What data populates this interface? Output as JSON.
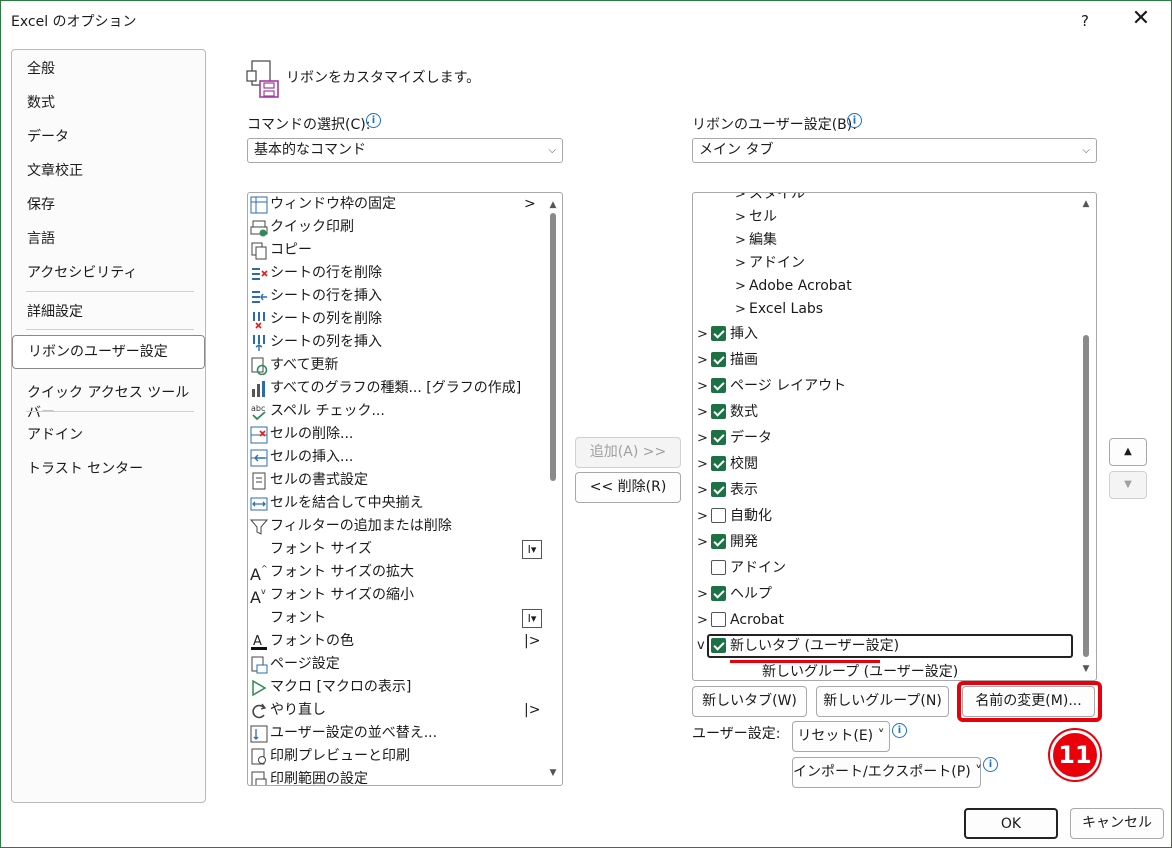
{
  "window": {
    "title": "Excel のオプション",
    "help": "?",
    "close": "✕"
  },
  "nav": {
    "items": [
      "全般",
      "数式",
      "データ",
      "文章校正",
      "保存",
      "言語",
      "アクセシビリティ",
      "詳細設定",
      "リボンのユーザー設定",
      "クイック アクセス ツール バー",
      "アドイン",
      "トラスト センター"
    ],
    "selected": "リボンのユーザー設定"
  },
  "header": {
    "text": "リボンをカスタマイズします。"
  },
  "commands": {
    "label": "コマンドの選択(C):",
    "combo_value": "基本的なコマンド",
    "items": [
      {
        "label": "ウィンドウ枠の固定",
        "icon": "freeze-panes-icon",
        "right": ">"
      },
      {
        "label": "クイック印刷",
        "icon": "quick-print-icon",
        "right": ""
      },
      {
        "label": "コピー",
        "icon": "copy-icon",
        "right": ""
      },
      {
        "label": "シートの行を削除",
        "icon": "delete-rows-icon",
        "right": ""
      },
      {
        "label": "シートの行を挿入",
        "icon": "insert-rows-icon",
        "right": ""
      },
      {
        "label": "シートの列を削除",
        "icon": "delete-columns-icon",
        "right": ""
      },
      {
        "label": "シートの列を挿入",
        "icon": "insert-columns-icon",
        "right": ""
      },
      {
        "label": "すべて更新",
        "icon": "refresh-all-icon",
        "right": ""
      },
      {
        "label": "すべてのグラフの種類... [グラフの作成]",
        "icon": "chart-icon",
        "right": ""
      },
      {
        "label": "スペル チェック...",
        "icon": "spelling-icon",
        "right": ""
      },
      {
        "label": "セルの削除...",
        "icon": "delete-cells-icon",
        "right": ""
      },
      {
        "label": "セルの挿入...",
        "icon": "insert-cells-icon",
        "right": ""
      },
      {
        "label": "セルの書式設定",
        "icon": "format-cells-icon",
        "right": ""
      },
      {
        "label": "セルを結合して中央揃え",
        "icon": "merge-center-icon",
        "right": ""
      },
      {
        "label": "フィルターの追加または削除",
        "icon": "filter-icon",
        "right": ""
      },
      {
        "label": "フォント サイズ",
        "icon": "",
        "right": "I▾"
      },
      {
        "label": "フォント サイズの拡大",
        "icon": "font-grow-icon",
        "right": ""
      },
      {
        "label": "フォント サイズの縮小",
        "icon": "font-shrink-icon",
        "right": ""
      },
      {
        "label": "フォント",
        "icon": "",
        "right": "I▾"
      },
      {
        "label": "フォントの色",
        "icon": "font-color-icon",
        "right": "|>"
      },
      {
        "label": "ページ設定",
        "icon": "page-setup-icon",
        "right": ""
      },
      {
        "label": "マクロ [マクロの表示]",
        "icon": "macro-icon",
        "right": ""
      },
      {
        "label": "やり直し",
        "icon": "redo-icon",
        "right": "|>"
      },
      {
        "label": "ユーザー設定の並べ替え...",
        "icon": "custom-sort-icon",
        "right": ""
      },
      {
        "label": "印刷プレビューと印刷",
        "icon": "print-preview-icon",
        "right": ""
      },
      {
        "label": "印刷範囲の設定",
        "icon": "print-area-icon",
        "right": ""
      }
    ]
  },
  "middle": {
    "add_label": "追加(A) >>",
    "remove_label": "<< 削除(R)"
  },
  "ribbon": {
    "label": "リボンのユーザー設定(B):",
    "combo_value": "メイン タブ",
    "items": [
      {
        "label": "スタイル",
        "level": 2,
        "expander": ">",
        "check": "none"
      },
      {
        "label": "セル",
        "level": 2,
        "expander": ">",
        "check": "none"
      },
      {
        "label": "編集",
        "level": 2,
        "expander": ">",
        "check": "none"
      },
      {
        "label": "アドイン",
        "level": 2,
        "expander": ">",
        "check": "none"
      },
      {
        "label": "Adobe Acrobat",
        "level": 2,
        "expander": ">",
        "check": "none"
      },
      {
        "label": "Excel Labs",
        "level": 2,
        "expander": ">",
        "check": "none"
      },
      {
        "label": "挿入",
        "level": 1,
        "expander": ">",
        "check": "on"
      },
      {
        "label": "描画",
        "level": 1,
        "expander": ">",
        "check": "on"
      },
      {
        "label": "ページ レイアウト",
        "level": 1,
        "expander": ">",
        "check": "on"
      },
      {
        "label": "数式",
        "level": 1,
        "expander": ">",
        "check": "on"
      },
      {
        "label": "データ",
        "level": 1,
        "expander": ">",
        "check": "on"
      },
      {
        "label": "校閲",
        "level": 1,
        "expander": ">",
        "check": "on"
      },
      {
        "label": "表示",
        "level": 1,
        "expander": ">",
        "check": "on"
      },
      {
        "label": "自動化",
        "level": 1,
        "expander": ">",
        "check": "off"
      },
      {
        "label": "開発",
        "level": 1,
        "expander": ">",
        "check": "on"
      },
      {
        "label": "アドイン",
        "level": 1,
        "expander": "",
        "check": "off"
      },
      {
        "label": "ヘルプ",
        "level": 1,
        "expander": ">",
        "check": "on"
      },
      {
        "label": "Acrobat",
        "level": 1,
        "expander": ">",
        "check": "off"
      },
      {
        "label": "新しいタブ (ユーザー設定)",
        "level": 1,
        "expander": "v",
        "check": "on"
      },
      {
        "label": "新しいグループ (ユーザー設定)",
        "level": 3,
        "expander": "",
        "check": "none"
      }
    ],
    "new_tab": "新しいタブ(W)",
    "new_group": "新しいグループ(N)",
    "rename": "名前の変更(M)...",
    "custom_label": "ユーザー設定:",
    "reset": "リセット(E) ˅",
    "import_export": "インポート/エクスポート(P) ˅",
    "move_up": "▲",
    "move_down": "▼"
  },
  "annotation": {
    "step": "11",
    "highlight_color": "#e8000b"
  },
  "footer": {
    "ok": "OK",
    "cancel": "キャンセル"
  }
}
